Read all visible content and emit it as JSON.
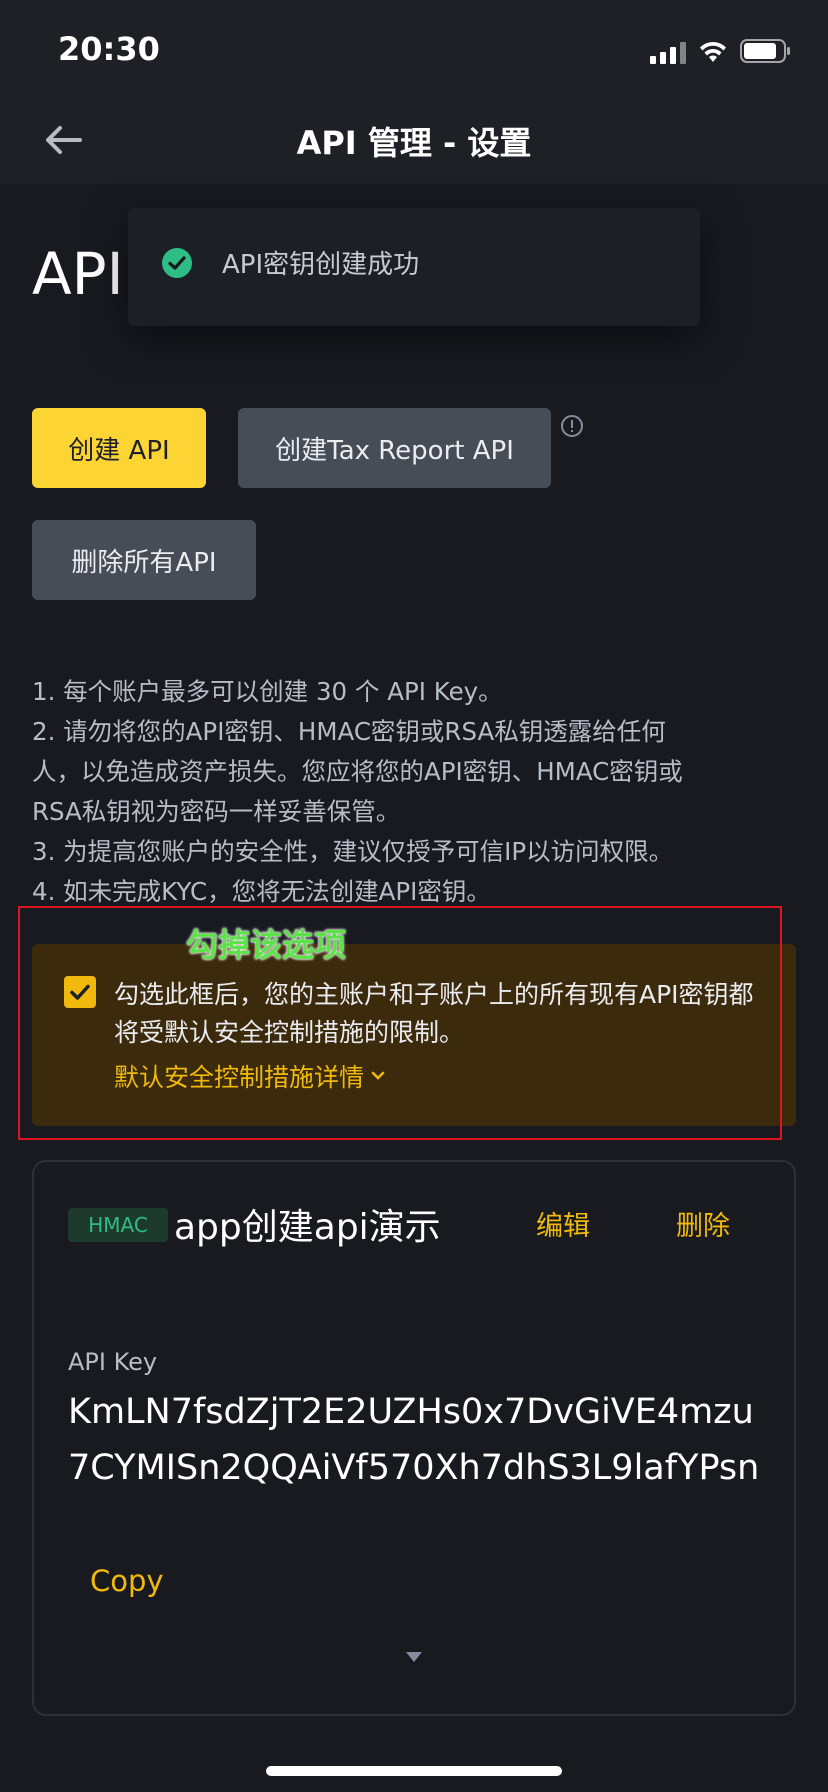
{
  "status_bar": {
    "time": "20:30"
  },
  "nav": {
    "title": "API 管理 - 设置"
  },
  "page": {
    "heading": "API"
  },
  "toast": {
    "message": "API密钥创建成功"
  },
  "buttons": {
    "create_api": "创建 API",
    "create_tax_api": "创建Tax Report API",
    "delete_all": "删除所有API"
  },
  "notes": [
    "1. 每个账户最多可以创建 30 个 API Key。",
    "2. 请勿将您的API密钥、HMAC密钥或RSA私钥透露给任何",
    "人，以免造成资产损失。您应将您的API密钥、HMAC密钥或",
    "RSA私钥视为密码一样妥善保管。",
    "3. 为提高您账户的安全性，建议仅授予可信IP以访问权限。",
    "4. 如未完成KYC，您将无法创建API密钥。"
  ],
  "annotation": {
    "label": "勾掉该选项"
  },
  "security": {
    "checked": true,
    "text": "勾选此框后，您的主账户和子账户上的所有现有API密钥都将受默认安全控制措施的限制。",
    "link": "默认安全控制措施详情"
  },
  "api_card": {
    "badge": "HMAC",
    "name": "app创建api演示",
    "edit": "编辑",
    "delete": "删除",
    "key_label": "API Key",
    "key_value": "KmLN7fsdZjT2E2UZHs0x7DvGiVE4mzu7CYMISn2QQAiVf570Xh7dhS3L9lafYPsn",
    "copy": "Copy"
  },
  "colors": {
    "background": "#181a20",
    "accent": "#f0b90b",
    "primary_button": "#fcd535",
    "success": "#2ebd85",
    "annotation": "#e0141f"
  }
}
